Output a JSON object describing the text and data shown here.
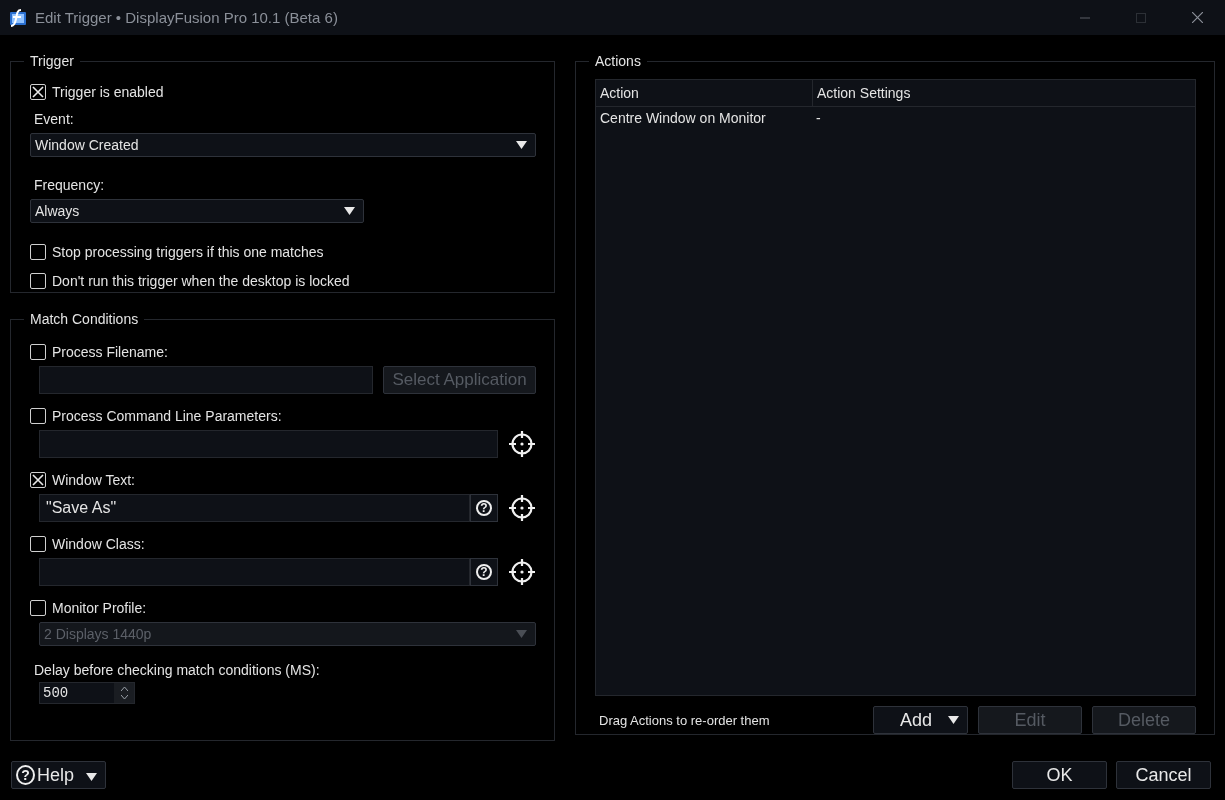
{
  "window": {
    "title": "Edit Trigger • DisplayFusion Pro 10.1 (Beta 6)"
  },
  "trigger": {
    "title": "Trigger",
    "enabled": {
      "label": "Trigger is enabled",
      "checked": true
    },
    "event": {
      "label": "Event:",
      "value": "Window Created"
    },
    "frequency": {
      "label": "Frequency:",
      "value": "Always"
    },
    "options": [
      {
        "label": "Stop processing triggers if this one matches",
        "checked": false
      },
      {
        "label": "Don't run this trigger when the desktop is locked",
        "checked": false
      }
    ]
  },
  "match_conditions": {
    "title": "Match Conditions",
    "conditions": [
      {
        "kind": "app",
        "label": "Process Filename:",
        "checked": false,
        "button": {
          "label": "Select Application",
          "disabled": true
        }
      },
      {
        "kind": "picker",
        "label": "Process Command Line Parameters:",
        "checked": false
      },
      {
        "kind": "text_help",
        "label": "Window Text:",
        "checked": true,
        "value": "\"Save As\"",
        "help_glyph": "?"
      },
      {
        "kind": "text_help",
        "label": "Window Class:",
        "checked": false,
        "help_glyph": "?"
      },
      {
        "kind": "dropdown",
        "label": "Monitor Profile:",
        "checked": false,
        "value": "2 Displays 1440p",
        "disabled": true
      }
    ],
    "delay": {
      "label": "Delay before checking match conditions (MS):",
      "value": "500"
    }
  },
  "actions": {
    "title": "Actions",
    "columns": [
      "Action",
      "Action Settings"
    ],
    "rows": [
      {
        "cells": [
          "Centre Window on Monitor",
          "-"
        ]
      }
    ],
    "hint": "Drag Actions to re-order them",
    "buttons": [
      {
        "label": "Add",
        "kind": "dropdown",
        "disabled": false
      },
      {
        "label": "Edit",
        "kind": "plain",
        "disabled": true
      },
      {
        "label": "Delete",
        "kind": "plain",
        "disabled": true
      }
    ]
  },
  "footer": {
    "help": {
      "label": "Help",
      "glyph": "?"
    },
    "buttons": [
      {
        "label": "OK"
      },
      {
        "label": "Cancel"
      }
    ]
  }
}
